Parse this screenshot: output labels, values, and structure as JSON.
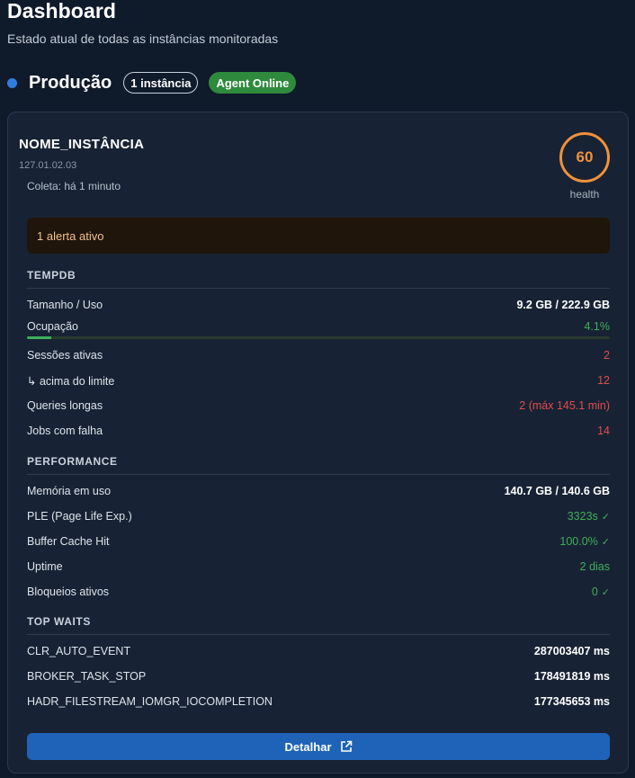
{
  "header": {
    "title": "Dashboard",
    "subtitle": "Estado atual de todas as instâncias monitoradas"
  },
  "environment": {
    "name": "Produção",
    "instance_count": "1 instância",
    "agent_status": "Agent Online"
  },
  "instance": {
    "name": "NOME_INSTÂNCIA",
    "ip": "127.01.02.03",
    "collected": "Coleta: há 1 minuto",
    "health_value": "60",
    "health_label": "health",
    "alert": "1 alerta ativo"
  },
  "tempdb": {
    "title": "TEMPDB",
    "size": {
      "label": "Tamanho / Uso",
      "value": "9.2 GB / 222.9 GB"
    },
    "occupancy": {
      "label": "Ocupação",
      "value": "4.1%",
      "fraction": 0.041
    },
    "sessions": {
      "label": "Sessões ativas",
      "value": "2"
    },
    "over_limit": {
      "label": "↳ acima do limite",
      "value": "12"
    },
    "long_queries": {
      "label": "Queries longas",
      "value": "2 (máx 145.1 min)"
    },
    "failed_jobs": {
      "label": "Jobs com falha",
      "value": "14"
    }
  },
  "performance": {
    "title": "PERFORMANCE",
    "memory": {
      "label": "Memória em uso",
      "value": "140.7 GB / 140.6 GB"
    },
    "ple": {
      "label": "PLE (Page Life Exp.)",
      "value": "3323s"
    },
    "buffer_cache": {
      "label": "Buffer Cache Hit",
      "value": "100.0%"
    },
    "uptime": {
      "label": "Uptime",
      "value": "2 dias"
    },
    "blocks": {
      "label": "Bloqueios ativos",
      "value": "0"
    }
  },
  "top_waits": {
    "title": "TOP WAITS",
    "items": [
      {
        "name": "CLR_AUTO_EVENT",
        "value": "287003407 ms"
      },
      {
        "name": "BROKER_TASK_STOP",
        "value": "178491819 ms"
      },
      {
        "name": "HADR_FILESTREAM_IOMGR_IOCOMPLETION",
        "value": "177345653 ms"
      }
    ]
  },
  "actions": {
    "detail_label": "Detalhar"
  },
  "colors": {
    "background": "#0f1a2b",
    "card": "#172334",
    "accent_blue": "#1f63b8",
    "status_green": "#3fae5a",
    "status_red": "#e24b4b",
    "health_orange": "#f0913a",
    "alert_text": "#f0c28a"
  },
  "icons": {
    "environment": "status-dot",
    "ok": "check-icon",
    "detail": "external-link-icon"
  }
}
